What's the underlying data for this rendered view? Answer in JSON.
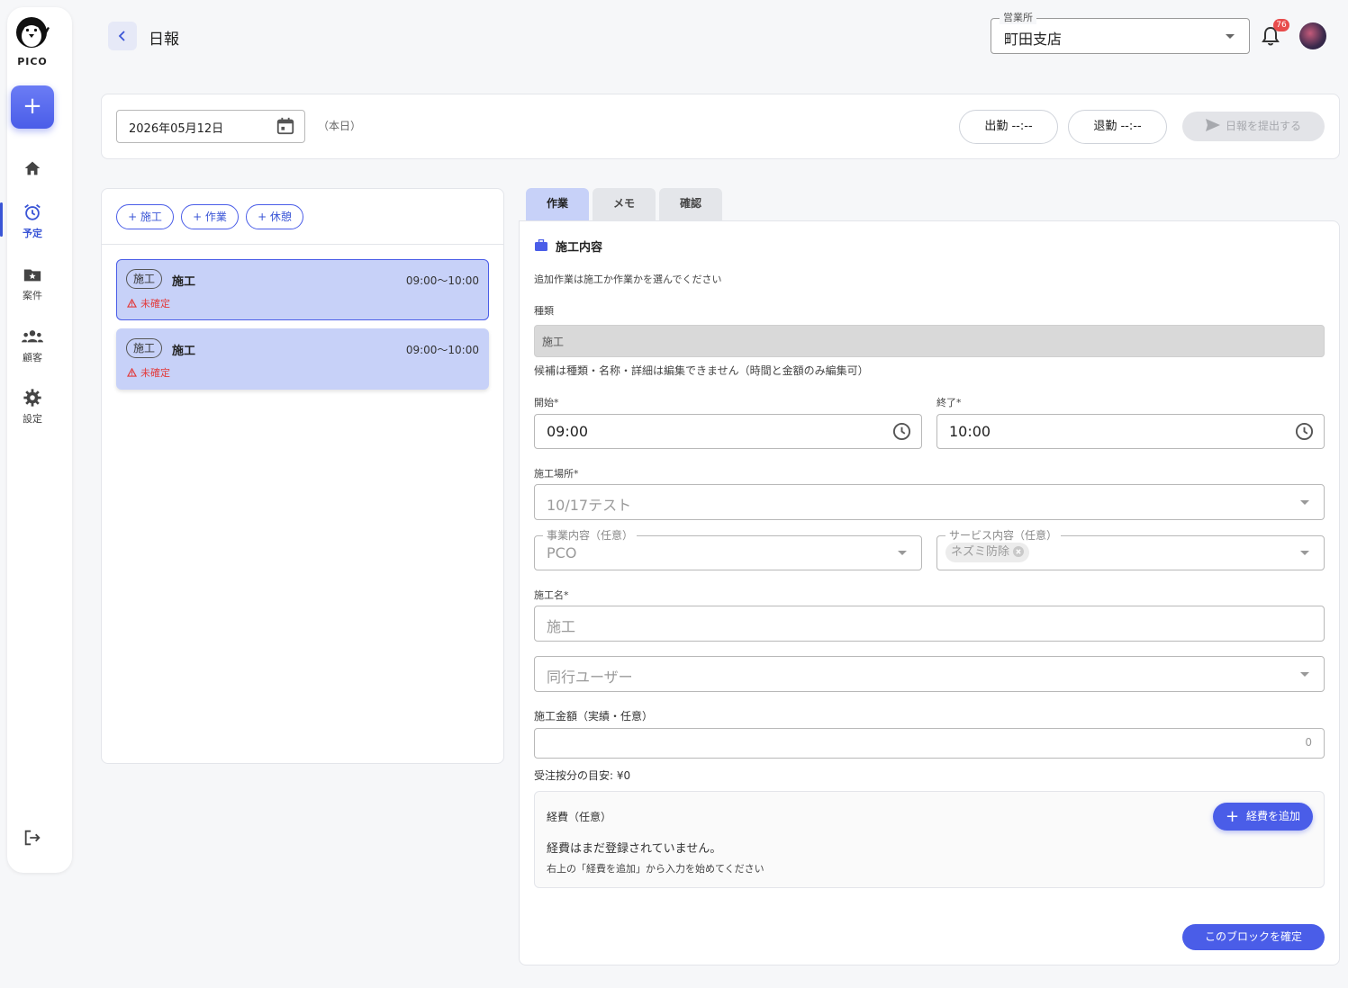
{
  "sidebar": {
    "logo_text": "PICO",
    "add_label": "+",
    "items": [
      {
        "label": "",
        "icon": "home-icon"
      },
      {
        "label": "予定",
        "icon": "alarm-clock-icon",
        "active": true
      },
      {
        "label": "案件",
        "icon": "folder-star-icon"
      },
      {
        "label": "顧客",
        "icon": "people-icon"
      },
      {
        "label": "設定",
        "icon": "gear-icon"
      }
    ]
  },
  "header": {
    "title": "日報",
    "office_label": "営業所",
    "office_value": "町田支店",
    "notification_count": "76"
  },
  "datebar": {
    "date": "2026年05月12日",
    "today_label": "（本日）",
    "clock_in": "出勤 --:--",
    "clock_out": "退勤 --:--",
    "submit": "日報を提出する"
  },
  "left": {
    "add_buttons": [
      "+ 施工",
      "+ 作業",
      "+ 休憩"
    ],
    "cards": [
      {
        "tag": "施工",
        "title": "施工",
        "time": "09:00〜10:00",
        "status": "未確定"
      },
      {
        "tag": "施工",
        "title": "施工",
        "time": "09:00〜10:00",
        "status": "未確定"
      }
    ]
  },
  "tabs": [
    "作業",
    "メモ",
    "確認"
  ],
  "form": {
    "section_title": "施工内容",
    "hint": "追加作業は施工か作業かを選んでください",
    "type_label": "種類",
    "type_value": "施工",
    "type_note": "候補は種類・名称・詳細は編集できません（時間と金額のみ編集可）",
    "start_label": "開始*",
    "start_value": "09:00",
    "end_label": "終了*",
    "end_value": "10:00",
    "location_label": "施工場所*",
    "location_value": "10/17テスト",
    "business_label": "事業内容（任意）",
    "business_value": "PCO",
    "service_label": "サービス内容（任意）",
    "service_chip": "ネズミ防除",
    "name_label": "施工名*",
    "name_placeholder": "施工",
    "companion_placeholder": "同行ユーザー",
    "amount_label": "施工金額（実績・任意）",
    "amount_value": "0",
    "estimate": "受注按分の目安: ¥0",
    "expense_label": "経費（任意）",
    "expense_add": "経費を追加",
    "expense_empty": "経費はまだ登録されていません。",
    "expense_hint": "右上の「経費を追加」から入力を始めてください",
    "confirm": "このブロックを確定"
  }
}
